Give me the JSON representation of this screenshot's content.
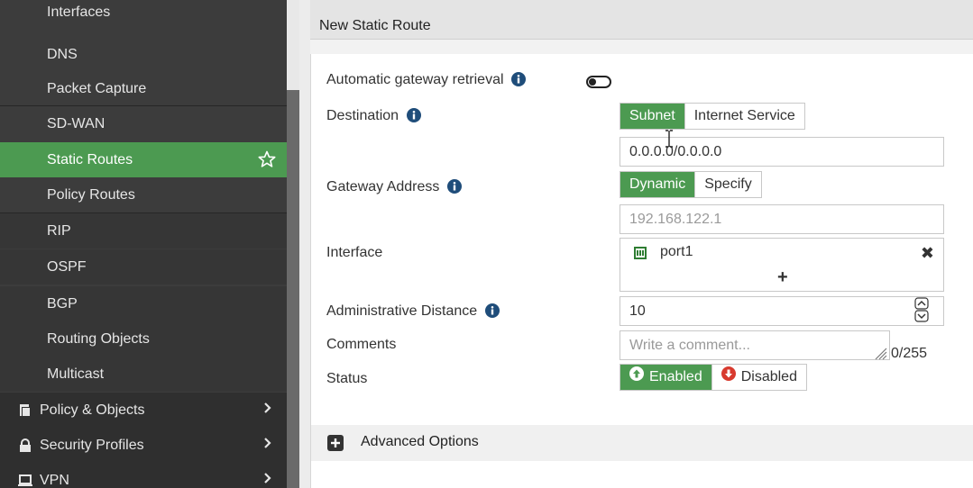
{
  "sidebar": {
    "items": [
      {
        "label": "Interfaces"
      },
      {
        "label": "DNS"
      },
      {
        "label": "Packet Capture"
      },
      {
        "label": "SD-WAN"
      },
      {
        "label": "Static Routes"
      },
      {
        "label": "Policy Routes"
      },
      {
        "label": "RIP"
      },
      {
        "label": "OSPF"
      },
      {
        "label": "BGP"
      },
      {
        "label": "Routing Objects"
      },
      {
        "label": "Multicast"
      }
    ],
    "sections": [
      {
        "label": "Policy & Objects",
        "icon": "policy-icon"
      },
      {
        "label": "Security Profiles",
        "icon": "lock-icon"
      },
      {
        "label": "VPN",
        "icon": "monitor-icon"
      }
    ]
  },
  "header": {
    "title": "New Static Route"
  },
  "form": {
    "auto_gateway_label": "Automatic gateway retrieval",
    "destination_label": "Destination",
    "destination_options": [
      "Subnet",
      "Internet Service"
    ],
    "destination_value": "0.0.0.0/0.0.0.0",
    "gateway_label": "Gateway Address",
    "gateway_options": [
      "Dynamic",
      "Specify"
    ],
    "gateway_value": "192.168.122.1",
    "interface_label": "Interface",
    "interface_value": "port1",
    "admin_distance_label": "Administrative Distance",
    "admin_distance_value": "10",
    "comments_label": "Comments",
    "comments_placeholder": "Write a comment...",
    "comments_count": "0/255",
    "status_label": "Status",
    "status_enabled": "Enabled",
    "status_disabled": "Disabled"
  },
  "advanced": {
    "label": "Advanced Options"
  },
  "colors": {
    "accent": "#4c9a51",
    "sidebar": "#3c3c3c",
    "disabled_red": "#d83a2e"
  }
}
